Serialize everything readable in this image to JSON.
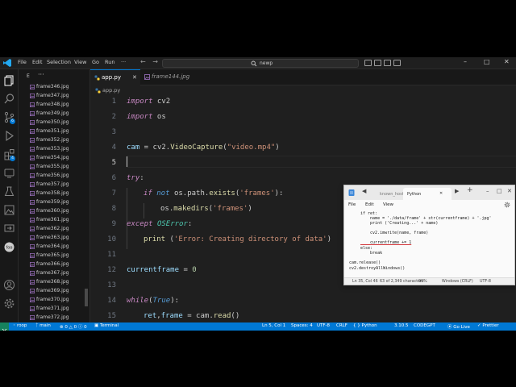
{
  "titlebar": {
    "menu": [
      "File",
      "Edit",
      "Selection",
      "View",
      "Go",
      "Run",
      "···"
    ],
    "search": "newp"
  },
  "sidebar": {
    "header": "E",
    "files": [
      "frame346.jpg",
      "frame347.jpg",
      "frame348.jpg",
      "frame349.jpg",
      "frame350.jpg",
      "frame351.jpg",
      "frame352.jpg",
      "frame353.jpg",
      "frame354.jpg",
      "frame355.jpg",
      "frame356.jpg",
      "frame357.jpg",
      "frame358.jpg",
      "frame359.jpg",
      "frame360.jpg",
      "frame361.jpg",
      "frame362.jpg",
      "frame363.jpg",
      "frame364.jpg",
      "frame365.jpg",
      "frame366.jpg",
      "frame367.jpg",
      "frame368.jpg",
      "frame369.jpg",
      "frame370.jpg",
      "frame371.jpg",
      "frame372.jpg"
    ]
  },
  "activity_badges": {
    "source_control": "6",
    "extensions": "4"
  },
  "tabs": [
    {
      "label": "app.py",
      "active": true
    },
    {
      "label": "frame144.jpg",
      "active": false
    }
  ],
  "breadcrumb": "app.py",
  "editor": {
    "line_numbers": [
      "1",
      "2",
      "3",
      "4",
      "5",
      "6",
      "7",
      "8",
      "9",
      "10",
      "11",
      "12",
      "13",
      "14",
      "15"
    ],
    "lines": {
      "l1": [
        "import",
        " cv2"
      ],
      "l2": [
        "import",
        " os"
      ],
      "l4": [
        "cam",
        " = ",
        "cv2",
        ".",
        "VideoCapture",
        "(",
        "\"video.mp4\"",
        ")"
      ],
      "l6": [
        "try",
        ":"
      ],
      "l7": [
        "if",
        " ",
        "not",
        " ",
        "os",
        ".",
        "path",
        ".",
        "exists",
        "(",
        "'frames'",
        "):"
      ],
      "l8": [
        "os",
        ".",
        "makedirs",
        "(",
        "'frames'",
        ")"
      ],
      "l9": [
        "except",
        " ",
        "OSError",
        ":"
      ],
      "l10": [
        "print",
        " (",
        "'Error: Creating directory of data'",
        ")"
      ],
      "l12": [
        "currentframe",
        " = ",
        "0"
      ],
      "l14": [
        "while",
        "(",
        "True",
        "):"
      ],
      "l15": [
        "ret",
        ",",
        "frame",
        " = ",
        "cam",
        ".",
        "read",
        "()"
      ]
    }
  },
  "notepad": {
    "tabs": [
      "known_host",
      "Python"
    ],
    "menu": [
      "File",
      "Edit",
      "View"
    ],
    "lines": [
      "if ret:",
      "    name = './data/frame' + str(currentframe) + '.jpg'",
      "    print ('Creating...' + name)",
      "",
      "    cv2.imwrite(name, frame)",
      "",
      "    currentframe += 1",
      "else:",
      "    break",
      "",
      "cam.release()",
      "cv2.destroyAllWindows()"
    ],
    "status": {
      "position": "Ln 35, Col 46",
      "chars": "63 of 2,349 characters",
      "zoom": "90%",
      "eol": "Windows (CRLF)",
      "encoding": "UTF-8"
    }
  },
  "statusbar": {
    "branch_folder": "roop",
    "branch": "main",
    "errors": "0",
    "warnings": "0",
    "info": "0",
    "terminal": "Terminal",
    "position": "Ln 5, Col 1",
    "spaces": "Spaces: 4",
    "encoding": "UTF-8",
    "eol": "CRLF",
    "language": "Python",
    "version": "3.10.5",
    "codegpt": "CODEGPT",
    "golive": "Go Live",
    "prettier": "Prettier"
  },
  "colors": {
    "accent": "#0078d4",
    "keyword": "#c586c0",
    "string": "#ce9178",
    "function": "#dcdcaa",
    "class": "#4ec9b0"
  }
}
